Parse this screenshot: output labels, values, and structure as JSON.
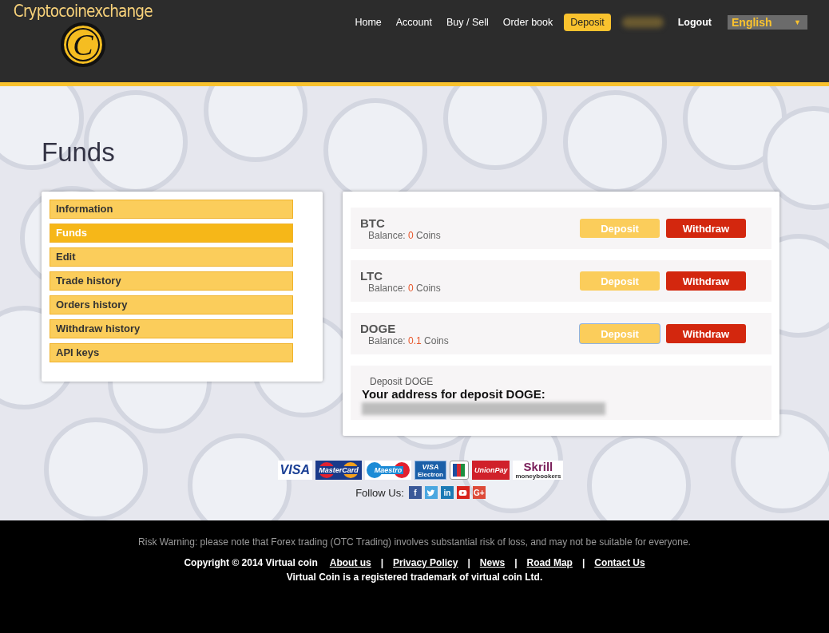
{
  "header": {
    "logo_text": "Cryptocoinexchange",
    "logo_letter": "C",
    "nav": [
      {
        "label": "Home",
        "selected": false
      },
      {
        "label": "Account",
        "selected": false
      },
      {
        "label": "Buy / Sell",
        "selected": false
      },
      {
        "label": "Order book",
        "selected": false
      },
      {
        "label": "Deposit",
        "selected": true
      }
    ],
    "logout": "Logout",
    "language": {
      "value": "English",
      "caret": "▼"
    }
  },
  "page_title": "Funds",
  "sidebar": {
    "items": [
      {
        "label": "Information",
        "selected": false
      },
      {
        "label": "Funds",
        "selected": true
      },
      {
        "label": "Edit",
        "selected": false
      },
      {
        "label": "Trade history",
        "selected": false
      },
      {
        "label": "Orders history",
        "selected": false
      },
      {
        "label": "Withdraw history",
        "selected": false
      },
      {
        "label": "API keys",
        "selected": false
      }
    ]
  },
  "wallets": [
    {
      "currency": "BTC",
      "balance_label": "Balance:",
      "amount": "0",
      "unit": "Coins",
      "deposit": "Deposit",
      "withdraw": "Withdraw",
      "deposit_focused": false
    },
    {
      "currency": "LTC",
      "balance_label": "Balance:",
      "amount": "0",
      "unit": "Coins",
      "deposit": "Deposit",
      "withdraw": "Withdraw",
      "deposit_focused": false
    },
    {
      "currency": "DOGE",
      "balance_label": "Balance:",
      "amount": "0.1",
      "unit": "Coins",
      "deposit": "Deposit",
      "withdraw": "Withdraw",
      "deposit_focused": true
    }
  ],
  "deposit_panel": {
    "caption": "Deposit DOGE",
    "heading": "Your address for deposit DOGE:"
  },
  "payment_logos": [
    {
      "kind": "visa",
      "label": "VISA"
    },
    {
      "kind": "mastercard",
      "label": "MasterCard"
    },
    {
      "kind": "maestro",
      "label": "Maestro"
    },
    {
      "kind": "electron",
      "label": "VISA",
      "sublabel": "Electron"
    },
    {
      "kind": "jcb"
    },
    {
      "kind": "unionpay",
      "label": "UnionPay"
    },
    {
      "kind": "skrill",
      "label": "Skrill",
      "sublabel": "moneybookers"
    }
  ],
  "follow": {
    "label": "Follow Us:",
    "icons": [
      {
        "kind": "facebook",
        "label": "f"
      },
      {
        "kind": "twitter"
      },
      {
        "kind": "linkedin",
        "label": "in"
      },
      {
        "kind": "youtube"
      },
      {
        "kind": "googleplus",
        "label": "G+"
      }
    ]
  },
  "footer": {
    "risk_warning": "Risk Warning: please note that Forex trading (OTC Trading) involves substantial risk of loss, and may not be suitable for everyone.",
    "copyright": "Copyright © 2014 Virtual coin",
    "links": [
      "About us",
      "Privacy Policy",
      "News",
      "Road Map",
      "Contact Us"
    ],
    "separator": "|",
    "trademark": "Virtual Coin is a registered trademark of virtual coin Ltd."
  }
}
